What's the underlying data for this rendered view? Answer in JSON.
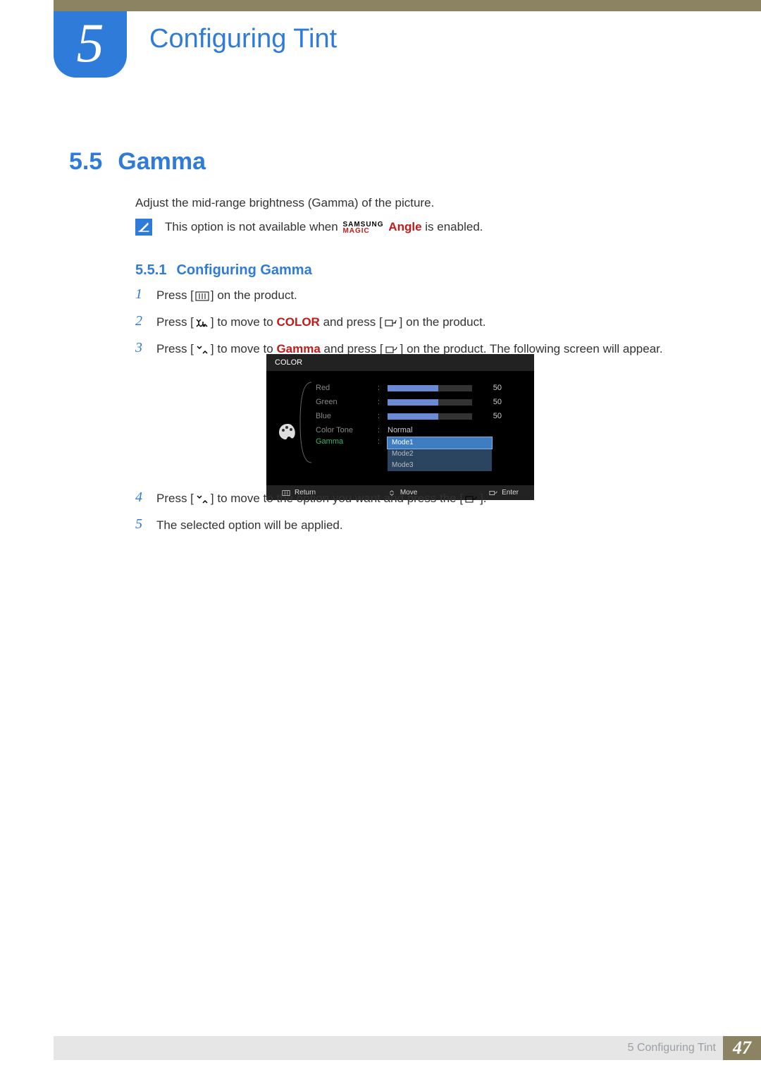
{
  "chapter": {
    "number": "5",
    "title": "Configuring Tint"
  },
  "section": {
    "number": "5.5",
    "title": "Gamma"
  },
  "intro": "Adjust the mid-range brightness (Gamma) of the picture.",
  "note": {
    "pre": "This option is not available when ",
    "magic_top": "SAMSUNG",
    "magic_bot": "MAGIC",
    "angle": "Angle",
    "post": " is enabled."
  },
  "subsection": {
    "number": "5.5.1",
    "title": "Configuring Gamma"
  },
  "steps": {
    "s1": {
      "n": "1",
      "a": "Press [",
      "b": "] on the product."
    },
    "s2": {
      "n": "2",
      "a": "Press [",
      "b": "] to move to ",
      "hl": "COLOR",
      "c": " and press [",
      "d": "] on the product."
    },
    "s3": {
      "n": "3",
      "a": "Press [",
      "b": "] to move to ",
      "hl": "Gamma",
      "c": " and press [",
      "d": "] on the product. The following screen will appear."
    },
    "s4": {
      "n": "4",
      "a": "Press [",
      "b": "] to move to the option you want and press the [",
      "c": "]."
    },
    "s5": {
      "n": "5",
      "a": "The selected option will be applied."
    }
  },
  "osd": {
    "title": "COLOR",
    "rows": {
      "red": {
        "label": "Red",
        "value": "50"
      },
      "green": {
        "label": "Green",
        "value": "50"
      },
      "blue": {
        "label": "Blue",
        "value": "50"
      },
      "tone": {
        "label": "Color Tone",
        "value": "Normal"
      },
      "gamma": {
        "label": "Gamma"
      }
    },
    "options": {
      "m1": "Mode1",
      "m2": "Mode2",
      "m3": "Mode3"
    },
    "footer": {
      "return": "Return",
      "move": "Move",
      "enter": "Enter"
    }
  },
  "footer": {
    "label": "5 Configuring Tint",
    "page": "47"
  }
}
